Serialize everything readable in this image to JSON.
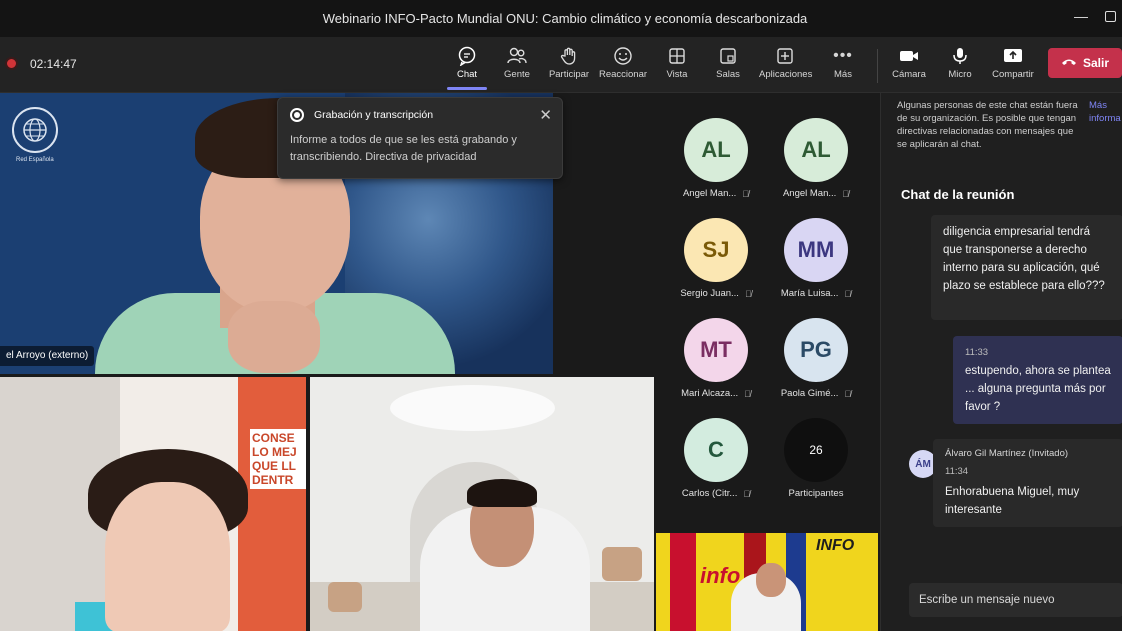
{
  "window": {
    "title": "Webinario INFO-Pacto Mundial ONU: Cambio climático y economía descarbonizada"
  },
  "toolbar": {
    "recording_time": "02:14:47",
    "buttons": [
      {
        "id": "chat",
        "label": "Chat",
        "icon": "chat-icon"
      },
      {
        "id": "people",
        "label": "Gente",
        "icon": "people-icon"
      },
      {
        "id": "raise",
        "label": "Participar",
        "icon": "hand-icon"
      },
      {
        "id": "react",
        "label": "Reaccionar",
        "icon": "smile-icon"
      },
      {
        "id": "view",
        "label": "Vista",
        "icon": "grid-icon"
      },
      {
        "id": "rooms",
        "label": "Salas",
        "icon": "rooms-icon"
      },
      {
        "id": "apps",
        "label": "Aplicaciones",
        "icon": "plus-square-icon"
      },
      {
        "id": "more",
        "label": "Más",
        "icon": "ellipsis-icon"
      },
      {
        "id": "camera",
        "label": "Cámara",
        "icon": "camera-icon"
      },
      {
        "id": "mic",
        "label": "Micro",
        "icon": "mic-icon"
      },
      {
        "id": "share",
        "label": "Compartir",
        "icon": "share-icon"
      }
    ],
    "leave_label": "Salir"
  },
  "stage": {
    "main_name": "el Arroyo (externo)",
    "logo_sub": "Red Española",
    "banner_text": "CONSE LO MEJ QUE LL DENTR",
    "info_sign1": "info",
    "info_sign2": "INFO",
    "notice": {
      "title": "Grabación y transcripción",
      "body": "Informe a todos de que se les está grabando y transcribiendo. Directiva de privacidad"
    },
    "participants": [
      {
        "initials": "AL",
        "name": "Angel Man...",
        "bg": "#d7ecd9",
        "fg": "#2e5a34"
      },
      {
        "initials": "AL",
        "name": "Angel Man...",
        "bg": "#d7ecd9",
        "fg": "#2e5a34"
      },
      {
        "initials": "SJ",
        "name": "Sergio Juan...",
        "bg": "#fbe7b3",
        "fg": "#7a5a08"
      },
      {
        "initials": "MM",
        "name": "María Luisa...",
        "bg": "#d9d6f3",
        "fg": "#3c3780"
      },
      {
        "initials": "MT",
        "name": "Mari Alcaza...",
        "bg": "#f3d6ea",
        "fg": "#7a2e62"
      },
      {
        "initials": "PG",
        "name": "Paola Gimé...",
        "bg": "#d8e4ef",
        "fg": "#2b4a66"
      },
      {
        "initials": "C",
        "name": "Carlos (Citr...",
        "bg": "#d3ecdf",
        "fg": "#24583d"
      }
    ],
    "more_count": "26",
    "more_label": "Participantes"
  },
  "chat": {
    "info_text": "Algunas personas de este chat están fuera de su organización. Es posible que tengan directivas relacionadas con mensajes que se aplicarán al chat.",
    "info_link": "Más informa",
    "title": "Chat de la reunión",
    "messages": [
      {
        "text": "diligencia empresarial tendrá que transponerse a derecho interno para su aplicación, qué plazo se establece para ello???"
      },
      {
        "time": "11:33",
        "text": "estupendo, ahora se plantea ... alguna pregunta más por favor ?"
      },
      {
        "avatar": "ÁM",
        "author": "Álvaro Gil Martínez (Invitado)",
        "time": "11:34",
        "text": "Enhorabuena Miguel, muy interesante"
      }
    ],
    "compose_placeholder": "Escribe un mensaje nuevo"
  }
}
